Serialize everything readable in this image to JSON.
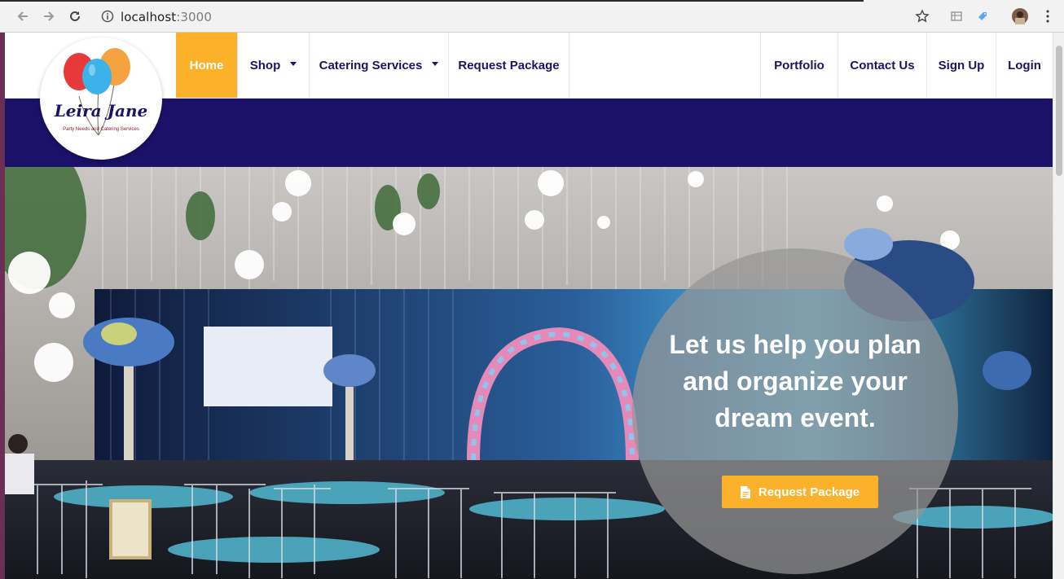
{
  "browser": {
    "url_host": "localhost",
    "url_port": ":3000"
  },
  "brand": {
    "name": "Leira Jane",
    "tagline": "Party Needs and Catering Services",
    "nav_active_color": "#fbb12a",
    "nav_text_color": "#1b1464",
    "band_color": "#1b1168"
  },
  "nav": {
    "home": "Home",
    "shop": "Shop",
    "catering": "Catering Services",
    "request_package": "Request Package",
    "portfolio": "Portfolio",
    "contact": "Contact Us",
    "signup": "Sign Up",
    "login": "Login"
  },
  "hero": {
    "headline": "Let us help you plan and organize your dream event.",
    "cta_label": "Request Package",
    "cta_icon": "document-icon"
  }
}
